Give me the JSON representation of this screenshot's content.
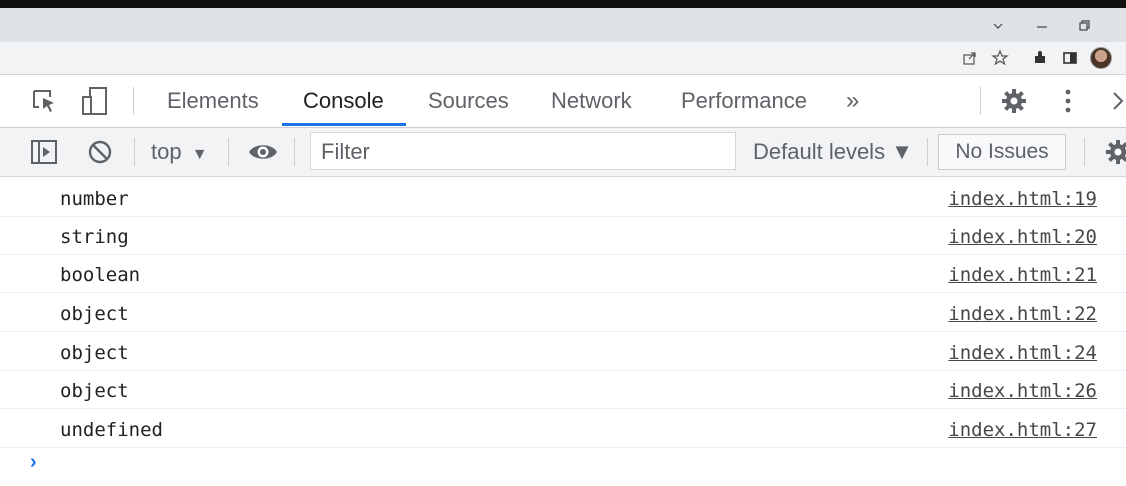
{
  "window": {
    "controls": [
      "chevron-down",
      "minimize",
      "restore"
    ]
  },
  "browser_toolbar": {
    "icons": [
      "share-icon",
      "star-icon",
      "extensions-icon",
      "sidepanel-icon",
      "avatar"
    ]
  },
  "devtools": {
    "tabs": [
      {
        "label": "Elements",
        "active": false
      },
      {
        "label": "Console",
        "active": true
      },
      {
        "label": "Sources",
        "active": false
      },
      {
        "label": "Network",
        "active": false
      },
      {
        "label": "Performance",
        "active": false
      }
    ],
    "more_tabs": "»"
  },
  "console_toolbar": {
    "context": "top",
    "context_arrow": "▼",
    "filter_placeholder": "Filter",
    "levels": "Default levels ▼",
    "issues": "No Issues"
  },
  "console": {
    "messages": [
      {
        "text": "number",
        "source": "index.html:19"
      },
      {
        "text": "string",
        "source": "index.html:20"
      },
      {
        "text": "boolean",
        "source": "index.html:21"
      },
      {
        "text": "object",
        "source": "index.html:22"
      },
      {
        "text": "object",
        "source": "index.html:24"
      },
      {
        "text": "object",
        "source": "index.html:26"
      },
      {
        "text": "undefined",
        "source": "index.html:27"
      }
    ],
    "prompt": "›"
  },
  "colors": {
    "accent": "#1a73e8",
    "text": "#202124",
    "muted": "#5f6368"
  }
}
